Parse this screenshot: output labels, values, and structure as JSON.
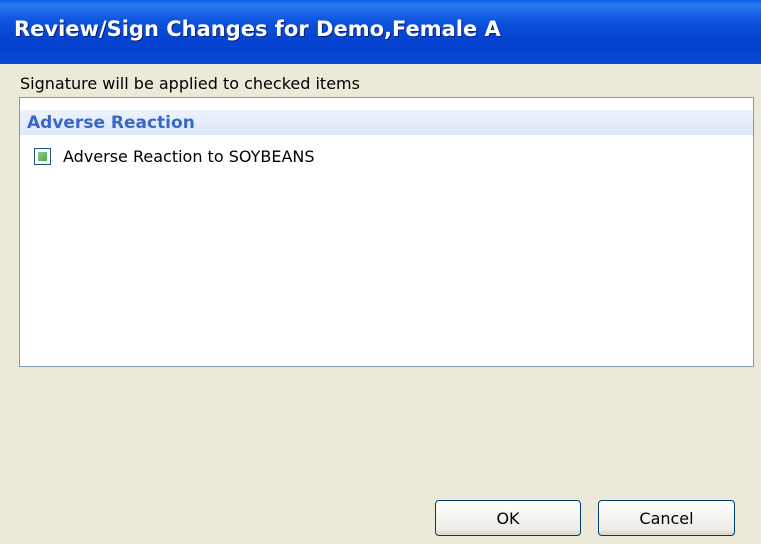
{
  "window": {
    "title": "Review/Sign Changes for Demo,Female A"
  },
  "instruction": "Signature will be applied to checked items",
  "list": {
    "group_header": "Adverse Reaction",
    "items": [
      {
        "label": "Adverse Reaction to SOYBEANS",
        "checked": true
      }
    ]
  },
  "buttons": {
    "ok_label": "OK",
    "cancel_label": "Cancel"
  },
  "colors": {
    "titlebar": "#0645D2",
    "dialog_bg": "#ECE9D8",
    "group_header_text": "#3867C9",
    "checkbox_fill": "#5CB85C"
  }
}
